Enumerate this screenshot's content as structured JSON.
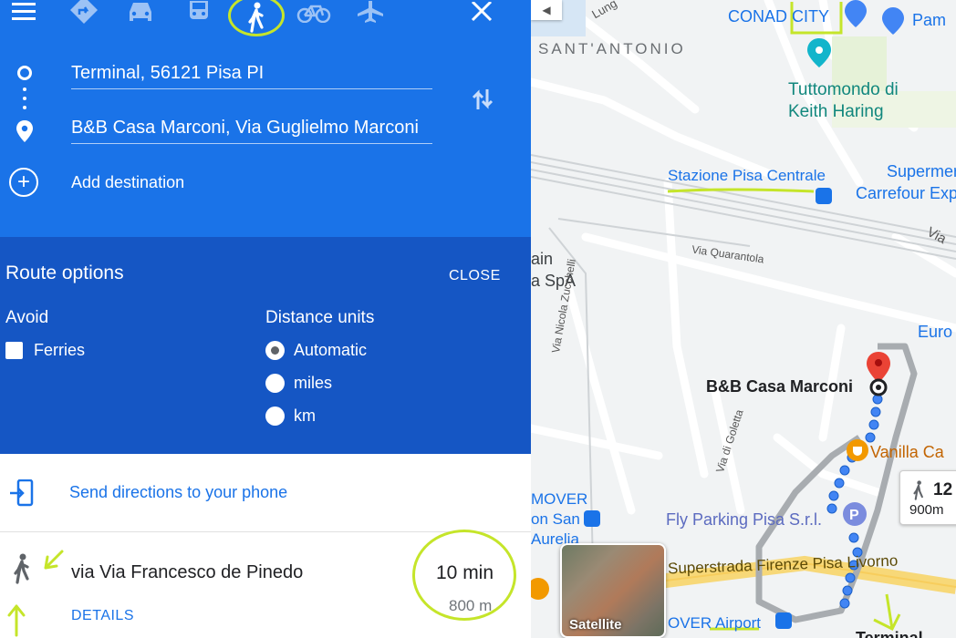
{
  "colors": {
    "header_blue": "#1a73e8",
    "options_blue": "#1556c4",
    "link_blue": "#1a73e8",
    "annotation_green": "#c5e52a",
    "route_dot_blue": "#4285f4",
    "pin_red": "#ea4335"
  },
  "header": {
    "menu_icon": "hamburger-menu-icon",
    "modes": [
      {
        "name": "best-route",
        "icon": "directions-diamond-icon"
      },
      {
        "name": "driving",
        "icon": "car-icon"
      },
      {
        "name": "transit",
        "icon": "train-icon"
      },
      {
        "name": "walking",
        "icon": "walking-person-icon",
        "selected": true
      },
      {
        "name": "cycling",
        "icon": "bicycle-icon"
      },
      {
        "name": "flight",
        "icon": "airplane-icon"
      }
    ],
    "close_icon": "close-icon",
    "origin": "Terminal, 56121 Pisa PI",
    "destination": "B&B Casa Marconi, Via Guglielmo Marconi",
    "add_destination": "Add destination",
    "swap_icon": "swap-vertical-icon"
  },
  "route_options": {
    "title": "Route options",
    "close": "CLOSE",
    "avoid_label": "Avoid",
    "ferries": "Ferries",
    "distance_units_label": "Distance units",
    "units": [
      "Automatic",
      "miles",
      "km"
    ],
    "selected_unit": "Automatic"
  },
  "send": {
    "label": "Send directions to your phone",
    "icon": "send-to-phone-icon"
  },
  "route": {
    "via": "via Via Francesco de Pinedo",
    "details": "DETAILS",
    "time": "10 min",
    "distance": "800 m"
  },
  "map": {
    "labels": {
      "lung": "Lung",
      "conad": "CONAD CITY",
      "pam": "Pam",
      "santantonio": "SANT'ANTONIO",
      "tuttomondo_1": "Tuttomondo di",
      "tuttomondo_2": "Keith Haring",
      "stazione": "Stazione Pisa Centrale",
      "supermercato": "Supermercato",
      "carrefour": "Carrefour Express",
      "via_quarantola": "Via Quarantola",
      "via_right": "Via",
      "ain": "ain",
      "a_spa": "a SpA",
      "via_zucchelli": "Via Nicola Zucchelli",
      "euro": "Euro",
      "bb_marconi": "B&B Casa Marconi",
      "via_goletta": "Via di Goletta",
      "vanilla": "Vanilla Ca",
      "mover": "MOVER",
      "on_san": "on San",
      "aurelia": "Aurelia",
      "fly_parking": "Fly Parking Pisa S.r.l.",
      "superstrada": "Superstrada Firenze Pisa Livorno",
      "mover_airport": "OVER Airport",
      "terminal": "Terminal"
    },
    "satellite": "Satellite",
    "chip_time": "12",
    "chip_distance": "900m"
  }
}
